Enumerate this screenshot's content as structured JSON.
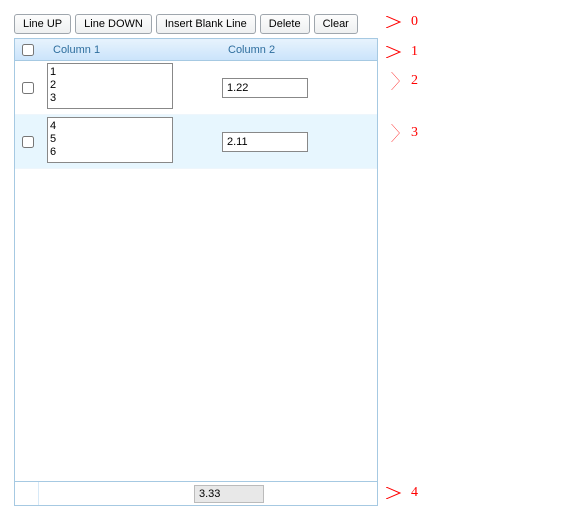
{
  "toolbar": {
    "line_up": "Line UP",
    "line_down": "Line DOWN",
    "insert_blank": "Insert Blank Line",
    "delete": "Delete",
    "clear": "Clear"
  },
  "grid": {
    "header": {
      "col1": "Column 1",
      "col2": "Column 2"
    },
    "rows": [
      {
        "col1": "1\n2\n3",
        "col2": "1.22"
      },
      {
        "col1": "4\n5\n6",
        "col2": "2.11"
      }
    ],
    "footer": {
      "col2": "3.33"
    }
  },
  "callouts": {
    "c0": "0",
    "c1": "1",
    "c2": "2",
    "c3": "3",
    "c4": "4"
  }
}
